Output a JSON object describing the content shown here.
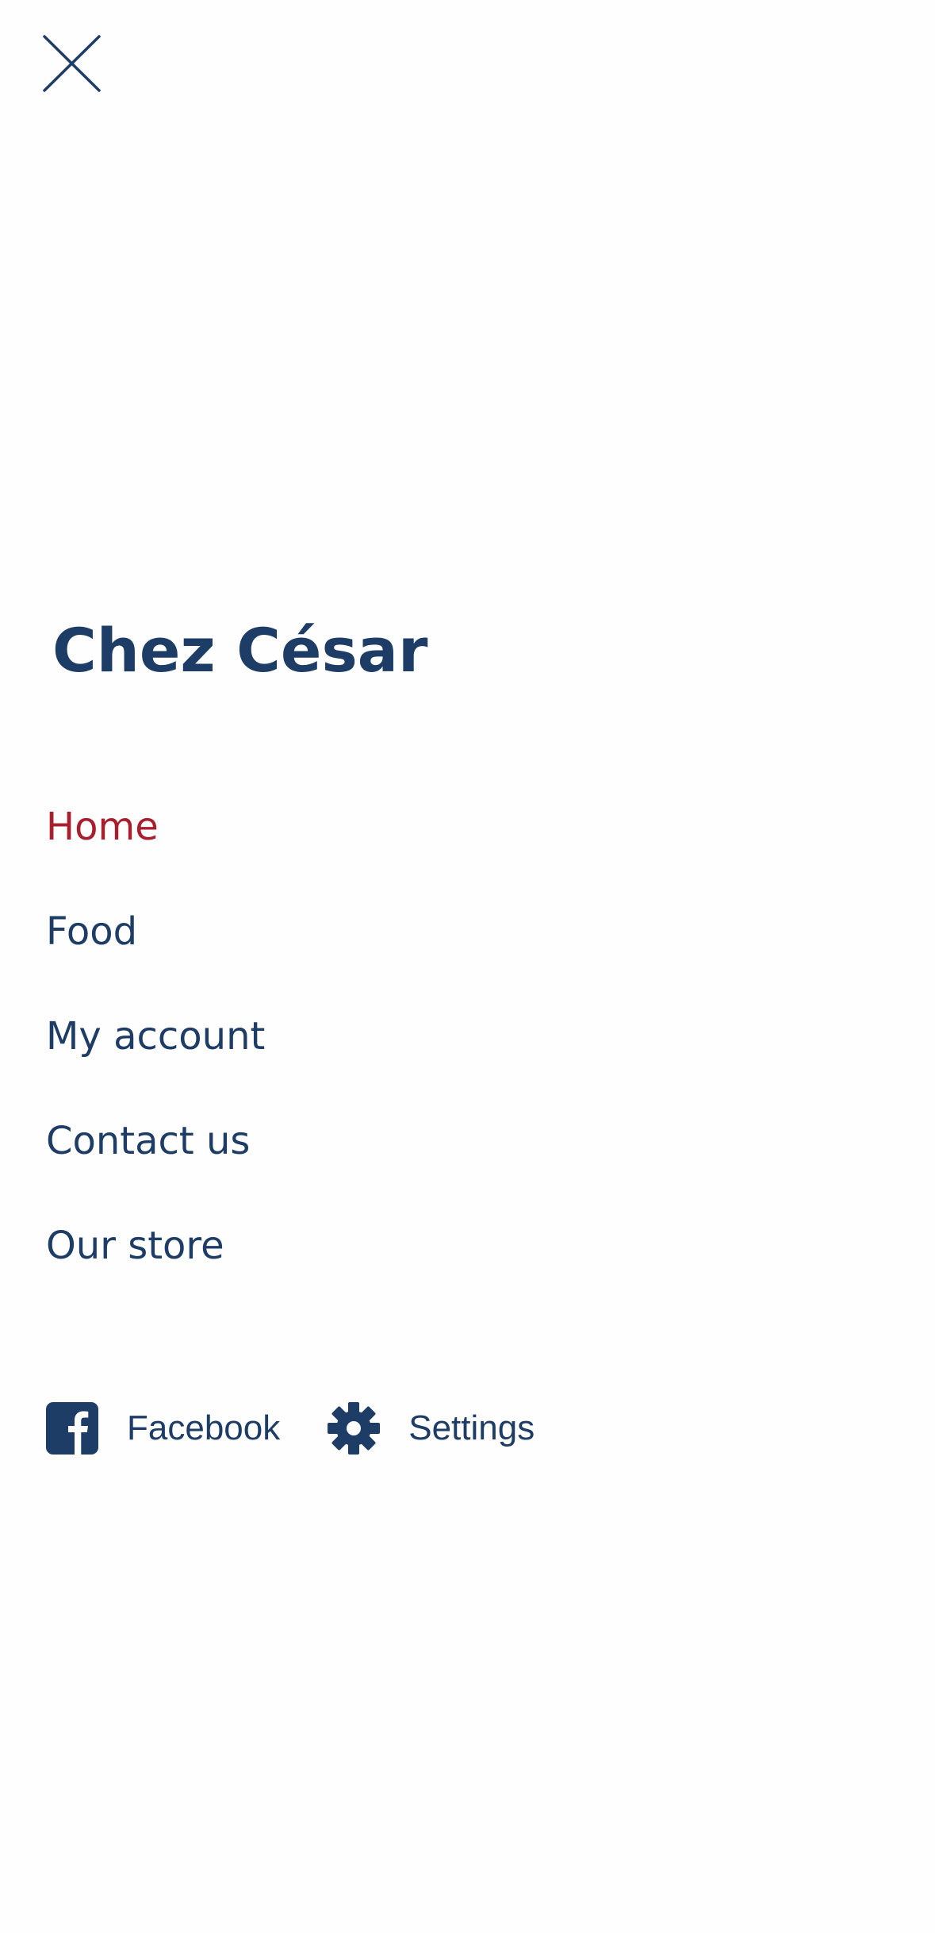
{
  "brand": {
    "title": "Chez César"
  },
  "header": {
    "close_icon": "close-icon"
  },
  "menu": {
    "items": [
      {
        "label": "Home",
        "active": true
      },
      {
        "label": "Food",
        "active": false
      },
      {
        "label": "My account",
        "active": false
      },
      {
        "label": "Contact us",
        "active": false
      },
      {
        "label": "Our store",
        "active": false
      }
    ]
  },
  "footer": {
    "facebook": {
      "label": "Facebook",
      "icon": "facebook-icon"
    },
    "settings": {
      "label": "Settings",
      "icon": "gear-icon"
    }
  },
  "colors": {
    "primary": "#1e3d66",
    "active": "#a91e2c",
    "background": "#fefefe"
  }
}
